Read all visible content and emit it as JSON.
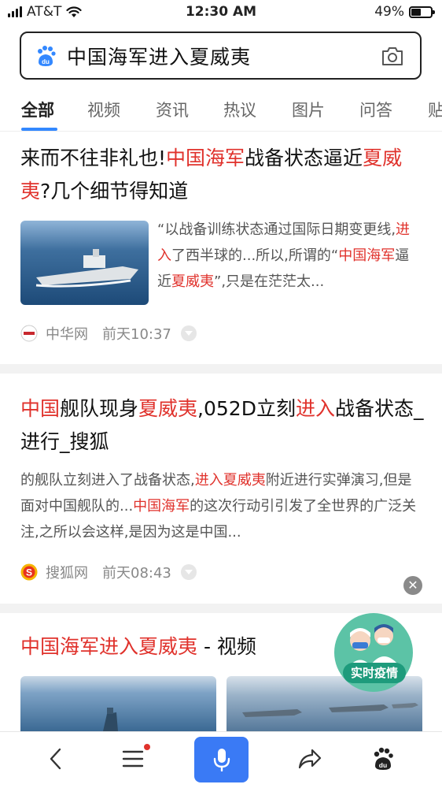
{
  "status": {
    "carrier": "AT&T",
    "time": "12:30 AM",
    "battery": "49%",
    "battery_level": 0.49
  },
  "search": {
    "query": "中国海军进入夏威夷",
    "logo_icon": "baidu-paw-icon",
    "camera_icon": "camera-icon"
  },
  "tabs": [
    "全部",
    "视频",
    "资讯",
    "热议",
    "图片",
    "问答",
    "贴"
  ],
  "results": [
    {
      "title": [
        {
          "t": "来而不往非礼也!",
          "h": false
        },
        {
          "t": "中国海军",
          "h": true
        },
        {
          "t": "战备状态逼近",
          "h": false
        },
        {
          "t": "夏威夷",
          "h": true
        },
        {
          "t": "?几个细节得知道",
          "h": false
        }
      ],
      "snippet": [
        {
          "t": "“以战备训练状态通过国际日期变更线,",
          "h": false
        },
        {
          "t": "进入",
          "h": true
        },
        {
          "t": "了西半球的...所以,所谓的“",
          "h": false
        },
        {
          "t": "中国海军",
          "h": true
        },
        {
          "t": "逼近",
          "h": false
        },
        {
          "t": "夏威夷",
          "h": true
        },
        {
          "t": "”,只是在茫茫太...",
          "h": false
        }
      ],
      "source": "中华网",
      "time": "前天10:37"
    },
    {
      "title": [
        {
          "t": "中国",
          "h": true
        },
        {
          "t": "舰队现身",
          "h": false
        },
        {
          "t": "夏威夷",
          "h": true
        },
        {
          "t": ",052D立刻",
          "h": false
        },
        {
          "t": "进入",
          "h": true
        },
        {
          "t": "战备状态_进行_搜狐",
          "h": false
        }
      ],
      "snippet": [
        {
          "t": "的舰队立刻进入了战备状态,",
          "h": false
        },
        {
          "t": "进入夏威夷",
          "h": true
        },
        {
          "t": "附近进行实弹演习,但是面对中国舰队的...",
          "h": false
        },
        {
          "t": "中国海军",
          "h": true
        },
        {
          "t": "的这次行动引引发了全世界的广泛关注,之所以会这样,是因为这是中国...",
          "h": false
        }
      ],
      "source": "搜狐网",
      "time": "前天08:43"
    }
  ],
  "video_section": {
    "title": [
      {
        "t": "中国海军进入夏威夷",
        "h": true
      },
      {
        "t": " - 视频",
        "h": false
      }
    ]
  },
  "badge": {
    "label": "实时疫情"
  },
  "colors": {
    "highlight": "#e0322c",
    "accent": "#3388ff",
    "mic": "#3a7af5"
  },
  "nav": {
    "back_icon": "back-chevron-icon",
    "menu_icon": "menu-icon",
    "mic_icon": "microphone-icon",
    "share_icon": "share-icon",
    "home_icon": "baidu-paw-icon"
  }
}
